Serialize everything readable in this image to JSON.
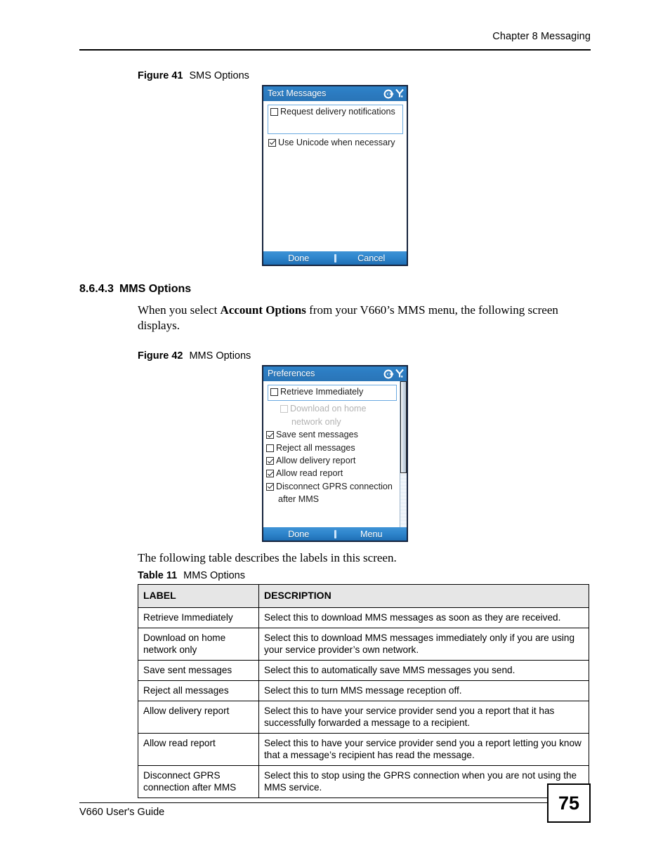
{
  "header": {
    "chapter": "Chapter 8 Messaging"
  },
  "footer": {
    "guide": "V660 User's Guide",
    "page_number": "75"
  },
  "figure41": {
    "label": "Figure 41",
    "title": "SMS Options",
    "screen": {
      "titlebar": "Text Messages",
      "icons": [
        "sync-icon",
        "signal-icon"
      ],
      "items": [
        {
          "label": "Request delivery notifications",
          "checked": false,
          "selected": true,
          "disabled": false
        },
        {
          "label": "Use Unicode when necessary",
          "checked": true,
          "selected": false,
          "disabled": false
        }
      ],
      "softkeys": {
        "left": "Done",
        "right": "Cancel"
      }
    }
  },
  "section": {
    "number": "8.6.4.3",
    "title": "MMS Options",
    "paragraph_pre": "When you select ",
    "paragraph_bold": "Account Options",
    "paragraph_post": " from your V660’s MMS menu, the following screen displays."
  },
  "figure42": {
    "label": "Figure 42",
    "title": "MMS Options",
    "screen": {
      "titlebar": "Preferences",
      "icons": [
        "sync-icon",
        "signal-icon"
      ],
      "items": [
        {
          "label": "Retrieve Immediately",
          "checked": false,
          "selected": true,
          "disabled": false
        },
        {
          "label": "Download on home",
          "label2": "network only",
          "checked": false,
          "selected": false,
          "disabled": true
        },
        {
          "label": "Save sent messages",
          "checked": true,
          "selected": false,
          "disabled": false
        },
        {
          "label": "Reject all messages",
          "checked": false,
          "selected": false,
          "disabled": false
        },
        {
          "label": "Allow delivery report",
          "checked": true,
          "selected": false,
          "disabled": false
        },
        {
          "label": "Allow read report",
          "checked": true,
          "selected": false,
          "disabled": false
        },
        {
          "label": "Disconnect GPRS connection",
          "label2": "after MMS",
          "checked": true,
          "selected": false,
          "disabled": false
        }
      ],
      "softkeys": {
        "left": "Done",
        "right": "Menu"
      },
      "scrollbar": {
        "thumb_position": "top",
        "thumb_fraction": "63%"
      }
    }
  },
  "intro_table": "The following table describes the labels in this screen.",
  "table11": {
    "label": "Table 11",
    "title": "MMS Options",
    "columns": [
      "LABEL",
      "DESCRIPTION"
    ],
    "rows": [
      {
        "label": "Retrieve Immediately",
        "description": "Select this to download MMS messages as soon as they are received."
      },
      {
        "label": "Download on home network only",
        "description": "Select this to download MMS messages immediately only if you are using your service provider’s own network."
      },
      {
        "label": "Save sent messages",
        "description": "Select this to automatically save MMS messages you send."
      },
      {
        "label": "Reject all messages",
        "description": "Select this to turn MMS message reception off."
      },
      {
        "label": "Allow delivery report",
        "description": "Select this to have your service provider send you a report that it has successfully forwarded a message to a recipient."
      },
      {
        "label": "Allow read report",
        "description": "Select this to have your service provider send you a report letting you know that a message’s recipient has read the message."
      },
      {
        "label": "Disconnect GPRS connection after MMS",
        "description": "Select this to stop using the GPRS connection when you are not using the MMS service."
      }
    ]
  },
  "colors": {
    "titlebar_blue": "#2c7cc2",
    "softkey_blue": "#2f86cd",
    "selection_outline": "#6aa9e0",
    "table_header_bg": "#e6e6e6",
    "device_border": "#14223c"
  }
}
